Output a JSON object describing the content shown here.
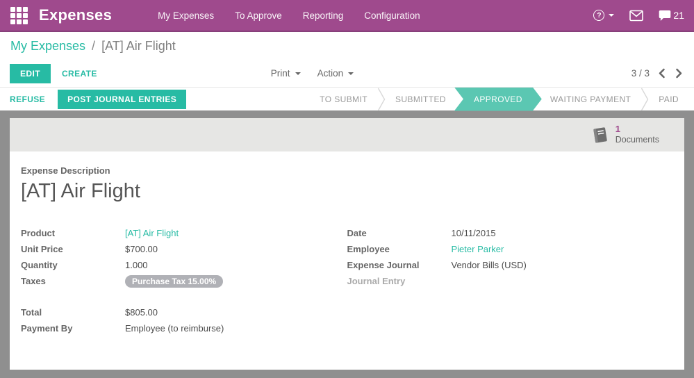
{
  "navbar": {
    "app_title": "Expenses",
    "menu_items": [
      {
        "label": "My Expenses"
      },
      {
        "label": "To Approve"
      },
      {
        "label": "Reporting"
      },
      {
        "label": "Configuration"
      }
    ],
    "help_glyph": "?",
    "messages_count": "21"
  },
  "breadcrumb": {
    "parent": "My Expenses",
    "separator": "/",
    "current": "[AT] Air Flight"
  },
  "control_panel": {
    "edit_label": "EDIT",
    "create_label": "CREATE",
    "print_label": "Print",
    "action_label": "Action",
    "pager_value": "3 / 3"
  },
  "statusbar": {
    "refuse_label": "REFUSE",
    "post_label": "POST JOURNAL ENTRIES",
    "stages": [
      {
        "label": "TO SUBMIT",
        "active": false
      },
      {
        "label": "SUBMITTED",
        "active": false
      },
      {
        "label": "APPROVED",
        "active": true
      },
      {
        "label": "WAITING PAYMENT",
        "active": false
      },
      {
        "label": "PAID",
        "active": false
      }
    ]
  },
  "sheet": {
    "documents_button": {
      "count": "1",
      "label": "Documents"
    },
    "description_label": "Expense Description",
    "title": "[AT] Air Flight",
    "fields_left": [
      {
        "label": "Product",
        "value": "[AT] Air Flight",
        "type": "link"
      },
      {
        "label": "Unit Price",
        "value": "$700.00",
        "type": "text"
      },
      {
        "label": "Quantity",
        "value": "1.000",
        "type": "text"
      },
      {
        "label": "Taxes",
        "value": "Purchase Tax 15.00%",
        "type": "tag"
      }
    ],
    "fields_right": [
      {
        "label": "Date",
        "value": "10/11/2015",
        "type": "text"
      },
      {
        "label": "Employee",
        "value": "Pieter Parker",
        "type": "link"
      },
      {
        "label": "Expense Journal",
        "value": "Vendor Bills (USD)",
        "type": "text"
      },
      {
        "label": "Journal Entry",
        "value": "",
        "type": "empty"
      }
    ],
    "totals": [
      {
        "label": "Total",
        "value": "$805.00"
      },
      {
        "label": "Payment By",
        "value": "Employee (to reimburse)"
      }
    ]
  },
  "colors": {
    "navbar_bg": "#9f4a8d",
    "accent_teal": "#27bba4",
    "stage_active": "#5bc7b2",
    "content_bg": "#8f8f8f",
    "strip_bg": "#e6e6e4",
    "tag_bg": "#b0b1b6"
  },
  "icons": {
    "apps": "3x3-grid",
    "help": "question-circle",
    "messages": "envelope",
    "chat": "speech-bubble",
    "documents": "book",
    "pager_prev": "chevron-left",
    "pager_next": "chevron-right"
  }
}
